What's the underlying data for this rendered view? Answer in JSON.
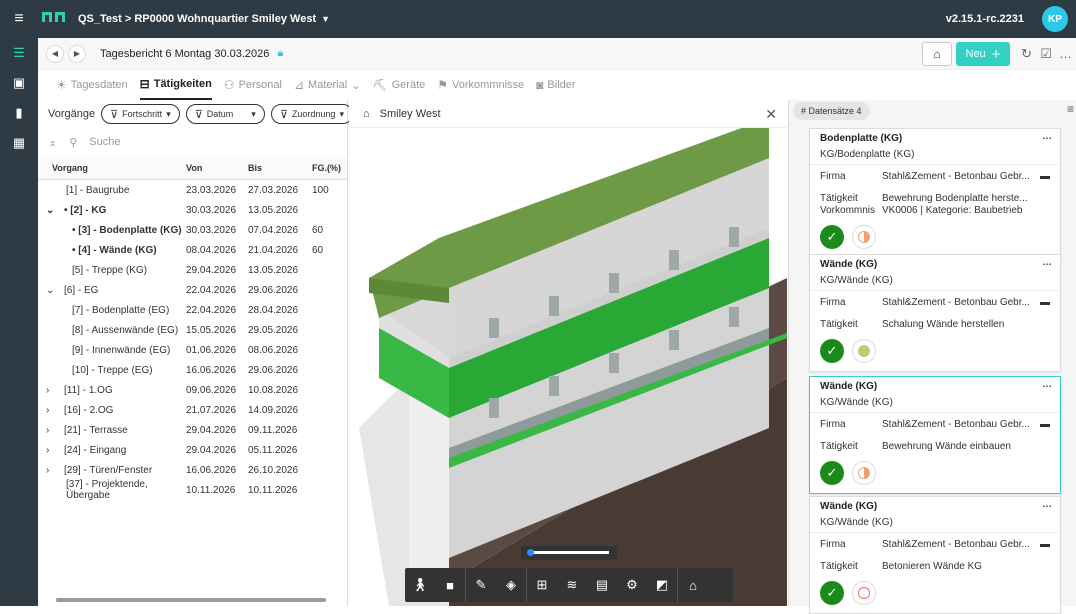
{
  "app": {
    "project": "QS_Test > RP0000 Wohnquartier Smiley West",
    "version": "v2.15.1-rc.2231",
    "user_initials": "KP"
  },
  "subbar": {
    "title": "Tagesbericht 6  Montag 30.03.2026",
    "new_label": "Neu"
  },
  "tabs": [
    {
      "label": "Tagesdaten",
      "icon": "sun-icon"
    },
    {
      "label": "Tätigkeiten",
      "icon": "gantt-icon",
      "active": true
    },
    {
      "label": "Personal",
      "icon": "people-icon"
    },
    {
      "label": "Material",
      "icon": "material-icon"
    },
    {
      "label": "Geräte",
      "icon": "excavator-icon"
    },
    {
      "label": "Vorkommnisse",
      "icon": "flag-icon"
    },
    {
      "label": "Bilder",
      "icon": "camera-icon"
    }
  ],
  "filters": {
    "label": "Vorgänge",
    "chips": [
      "Fortschritt",
      "Datum",
      "Zuordnung"
    ],
    "search_placeholder": "Suche"
  },
  "table": {
    "headers": [
      "Vorgang",
      "Von",
      "Bis",
      "FG.(%)"
    ],
    "rows": [
      {
        "name": "[1] - Baugrube",
        "von": "23.03.2026",
        "bis": "27.03.2026",
        "fg": "100",
        "indent": 1,
        "exp": ""
      },
      {
        "name": "• [2] - KG",
        "von": "30.03.2026",
        "bis": "13.05.2026",
        "fg": "",
        "indent": 0,
        "exp": "⌄",
        "bold": true
      },
      {
        "name": "• [3] - Bodenplatte (KG)",
        "von": "30.03.2026",
        "bis": "07.04.2026",
        "fg": "60",
        "indent": 2,
        "exp": "",
        "bold": true
      },
      {
        "name": "• [4] - Wände (KG)",
        "von": "08.04.2026",
        "bis": "21.04.2026",
        "fg": "60",
        "indent": 2,
        "exp": "",
        "bold": true
      },
      {
        "name": "[5] - Treppe (KG)",
        "von": "29.04.2026",
        "bis": "13.05.2026",
        "fg": "",
        "indent": 2,
        "exp": ""
      },
      {
        "name": "[6] - EG",
        "von": "22.04.2026",
        "bis": "29.06.2026",
        "fg": "",
        "indent": 0,
        "exp": "⌄"
      },
      {
        "name": "[7] - Bodenplatte (EG)",
        "von": "22.04.2026",
        "bis": "28.04.2026",
        "fg": "",
        "indent": 2,
        "exp": ""
      },
      {
        "name": "[8] - Aussenwände (EG)",
        "von": "15.05.2026",
        "bis": "29.05.2026",
        "fg": "",
        "indent": 2,
        "exp": ""
      },
      {
        "name": "[9] - Innenwände (EG)",
        "von": "01.06.2026",
        "bis": "08.06.2026",
        "fg": "",
        "indent": 2,
        "exp": ""
      },
      {
        "name": "[10] - Treppe (EG)",
        "von": "16.06.2026",
        "bis": "29.06.2026",
        "fg": "",
        "indent": 2,
        "exp": ""
      },
      {
        "name": "[11] - 1.OG",
        "von": "09.06.2026",
        "bis": "10.08.2026",
        "fg": "",
        "indent": 0,
        "exp": "›"
      },
      {
        "name": "[16] - 2.OG",
        "von": "21.07.2026",
        "bis": "14.09.2026",
        "fg": "",
        "indent": 0,
        "exp": "›"
      },
      {
        "name": "[21] - Terrasse",
        "von": "29.04.2026",
        "bis": "09.11.2026",
        "fg": "",
        "indent": 0,
        "exp": "›"
      },
      {
        "name": "[24] - Eingang",
        "von": "29.04.2026",
        "bis": "05.11.2026",
        "fg": "",
        "indent": 0,
        "exp": "›"
      },
      {
        "name": "[29] - Türen/Fenster",
        "von": "16.06.2026",
        "bis": "26.10.2026",
        "fg": "",
        "indent": 0,
        "exp": "›"
      },
      {
        "name": "[37] - Projektende, Übergabe",
        "von": "10.11.2026",
        "bis": "10.11.2026",
        "fg": "",
        "indent": 1,
        "exp": ""
      }
    ]
  },
  "viewer": {
    "title": "Smiley West"
  },
  "right": {
    "badge": "# Datensätze 4",
    "cards": [
      {
        "title": "Bodenplatte (KG)",
        "sub": "KG/Bodenplatte (KG)",
        "firma_label": "Firma",
        "firma": "Stahl&Zement - Betonbau Gebr...",
        "rows": [
          {
            "l": "Tätigkeit",
            "v": "Bewehrung Bodenplatte herste..."
          },
          {
            "l": "Vorkommnis",
            "v": "VK0006 | Kategorie: Baubetrieb"
          }
        ],
        "status_color": "#f0a070",
        "status": "half"
      },
      {
        "title": "Wände (KG)",
        "sub": "KG/Wände (KG)",
        "firma_label": "Firma",
        "firma": "Stahl&Zement - Betonbau Gebr...",
        "rows": [
          {
            "l": "Tätigkeit",
            "v": "Schalung Wände herstellen"
          }
        ],
        "status_color": "#b5d07a",
        "status": "full"
      },
      {
        "title": "Wände (KG)",
        "sub": "KG/Wände (KG)",
        "firma_label": "Firma",
        "firma": "Stahl&Zement - Betonbau Gebr...",
        "rows": [
          {
            "l": "Tätigkeit",
            "v": "Bewehrung Wände einbauen"
          }
        ],
        "status_color": "#f0a070",
        "status": "half",
        "selected": true
      },
      {
        "title": "Wände (KG)",
        "sub": "KG/Wände (KG)",
        "firma_label": "Firma",
        "firma": "Stahl&Zement - Betonbau Gebr...",
        "rows": [
          {
            "l": "Tätigkeit",
            "v": "Betonieren Wände KG"
          }
        ],
        "status_color": "#f07060",
        "status": "ring"
      }
    ]
  }
}
